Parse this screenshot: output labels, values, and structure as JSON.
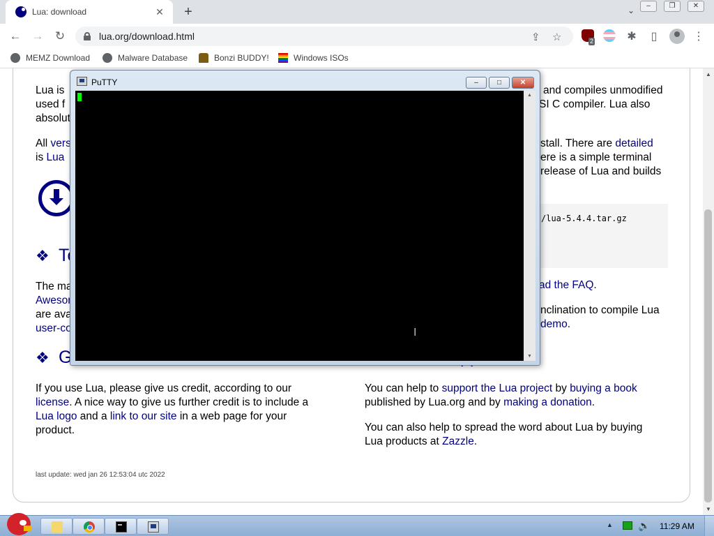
{
  "browser": {
    "tab_title": "Lua: download",
    "tab_close": "✕",
    "new_tab": "+",
    "tab_search": "⌄",
    "window_buttons": [
      "–",
      "❐",
      "✕"
    ],
    "nav": {
      "back": "←",
      "forward": "→",
      "reload": "↻"
    },
    "url": "lua.org/download.html",
    "omnibox_icons": {
      "share": "⇪",
      "bookmark": "☆"
    },
    "extension_badge": "2",
    "toolbar_icons": {
      "extensions": "✱",
      "sidepanel": "▯",
      "menu": "⋮"
    },
    "bookmarks": [
      {
        "label": "MEMZ Download"
      },
      {
        "label": "Malware Database"
      },
      {
        "label": "Bonzi BUDDY!"
      },
      {
        "label": "Windows ISOs"
      }
    ]
  },
  "page": {
    "p1_left_l1_a": "Lua is",
    "p1_left_l2": "used f",
    "p1_left_l3": "absolut",
    "p1_right_l1": "and compiles unmodified",
    "p1_right_l2": "SI C compiler. Lua also",
    "p2_left_l1_a": "All",
    "p2_left_l1_link": "vers",
    "p2_left_l2_a": "is",
    "p2_left_l2_link": "Lua",
    "p2_right_l1_a": "stall. There are",
    "p2_right_l1_link": "detailed",
    "p2_right_l2": "ere is a simple terminal",
    "p2_right_l3": "release of Lua and builds",
    "code_tail": "/lua-5.4.4.tar.gz",
    "tools_heading_fragment": "To",
    "p3_left_l1": "The ma",
    "p3_left_l2_link": "Awesor",
    "p3_left_l3": "are ava",
    "p3_left_l4_link": "user-co",
    "p3_right_l1_link": "ad the FAQ",
    "p3_right_l1_tail": ".",
    "p3_right_l3": "nclination to compile Lua",
    "p3_right_l4_link": "demo",
    "p3_right_l4_tail": ".",
    "giving_heading_fragment": "G",
    "support_heading_fragment": "pp",
    "credit": {
      "l1": "If you use Lua, please give us credit, according to our",
      "l2_link": "license",
      "l2_tail": ". A nice way to give us further credit is to include a",
      "l3_link1": "Lua logo",
      "l3_mid": "and a",
      "l3_link2": "link to our site",
      "l3_tail": "in a web page for your",
      "l4": "product."
    },
    "support": {
      "l1_a": "You can help to",
      "l1_link1": "support the Lua project",
      "l1_b": "by",
      "l1_link2": "buying a book",
      "l2_a": "published by Lua.org and by",
      "l2_link": "making a donation",
      "l2_tail": ".",
      "l3": "You can also help to spread the word about Lua by buying",
      "l4_a": "Lua products at",
      "l4_link": "Zazzle",
      "l4_tail": "."
    },
    "footer": "last update: wed jan 26 12:53:04 utc 2022",
    "diamond": "❖",
    "scroll_up": "▲",
    "scroll_down": "▼"
  },
  "putty": {
    "title": "PuTTY",
    "buttons": {
      "minimize": "–",
      "maximize": "□",
      "close": "✕"
    },
    "ibeam": "I",
    "scroll_up": "▲",
    "scroll_down": "▼"
  },
  "taskbar": {
    "tray_arrow": "▲",
    "volume": "🔊",
    "clock": "11:29 AM"
  }
}
